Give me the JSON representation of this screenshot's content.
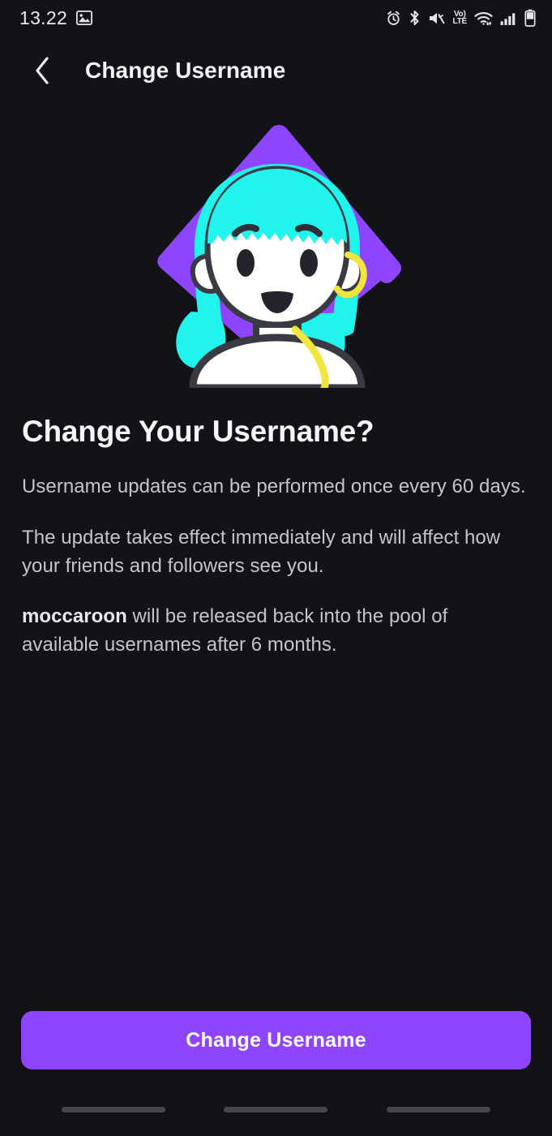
{
  "status_bar": {
    "time": "13.22",
    "left_icons": [
      {
        "name": "photo-icon",
        "label": "Screenshot"
      }
    ],
    "right_icons": [
      {
        "name": "alarm-icon",
        "label": "Alarm set"
      },
      {
        "name": "bluetooth-icon",
        "label": "Bluetooth on"
      },
      {
        "name": "mute-icon",
        "label": "Ringer muted"
      },
      {
        "name": "volte-icon",
        "label": "VoLTE",
        "line1": "Vo)",
        "line2": "LTE"
      },
      {
        "name": "wifi-icon",
        "label": "Wi-Fi"
      },
      {
        "name": "cellular-signal-icon",
        "label": "Signal"
      },
      {
        "name": "battery-icon",
        "label": "Battery"
      }
    ]
  },
  "app_bar": {
    "back_label": "Back",
    "title": "Change Username"
  },
  "illustration": {
    "name": "avatar-illustration",
    "alt": "Character with cyan hair in front of a purple diamond",
    "colors": {
      "diamond": "#8f45fd",
      "hair": "#21f4ec",
      "skin": "#ffffff",
      "outline": "#3a3a42",
      "accent_cable": "#f2e63c"
    }
  },
  "main": {
    "headline": "Change Your Username?",
    "paragraphs": [
      {
        "id": "frequency",
        "text": "Username updates can be performed once every 60 days."
      },
      {
        "id": "effect",
        "text": "The update takes effect immediately and will affect how your friends and followers see you."
      },
      {
        "id": "release",
        "username": "moccaroon",
        "rest": " will be released back into the pool of available usernames after 6 months."
      }
    ]
  },
  "footer": {
    "primary_button": "Change Username",
    "button_color": "#8f45fd"
  },
  "nav_bar": {
    "items": [
      {
        "name": "recents-button",
        "label": "Recents"
      },
      {
        "name": "home-button",
        "label": "Home"
      },
      {
        "name": "back-button",
        "label": "Back"
      }
    ]
  },
  "theme": {
    "background": "#121316",
    "accent": "#8f45fd",
    "text_primary": "#f4f5f8",
    "text_secondary": "#c4c5ca"
  }
}
